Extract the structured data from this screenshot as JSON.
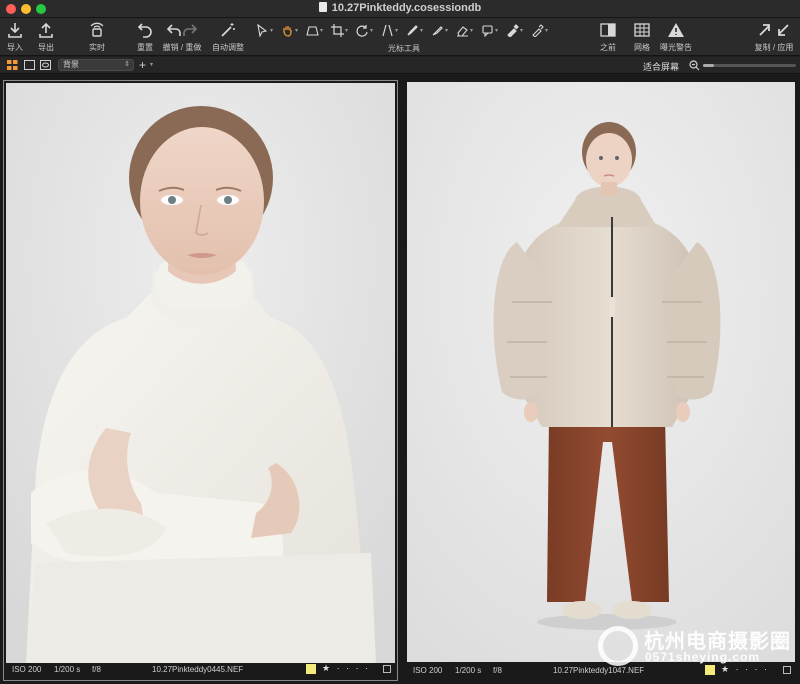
{
  "window": {
    "title": "10.27Pinkteddy.cosessiondb"
  },
  "toolbar": {
    "import_label": "导入",
    "export_label": "导出",
    "live_label": "实时",
    "reset_label": "重置",
    "undo_redo_label": "撤销 / 重做",
    "auto_adjust_label": "自动调整",
    "cursor_tools_label": "光标工具",
    "before_label": "之前",
    "grid_label": "网格",
    "exposure_warning_label": "曝光警告",
    "copy_apply_label": "复制 / 应用"
  },
  "subbar": {
    "background_select": "背景",
    "fit_screen_label": "适合屏幕",
    "zoom_level": 0.12
  },
  "viewer": {
    "left": {
      "iso": "ISO 200",
      "shutter": "1/200 s",
      "aperture": "f/8",
      "filename": "10.27Pinkteddy0445.NEF",
      "rating_display": "★ · · · ·",
      "color_tag": "#f3ea7a"
    },
    "right": {
      "iso": "ISO 200",
      "shutter": "1/200 s",
      "aperture": "f/8",
      "filename": "10.27Pinkteddy1047.NEF",
      "rating_display": "★ · · · ·",
      "color_tag": "#f3ea7a"
    }
  },
  "watermark": {
    "title": "杭州电商摄影圈",
    "subtitle": "0571sheying.com"
  }
}
